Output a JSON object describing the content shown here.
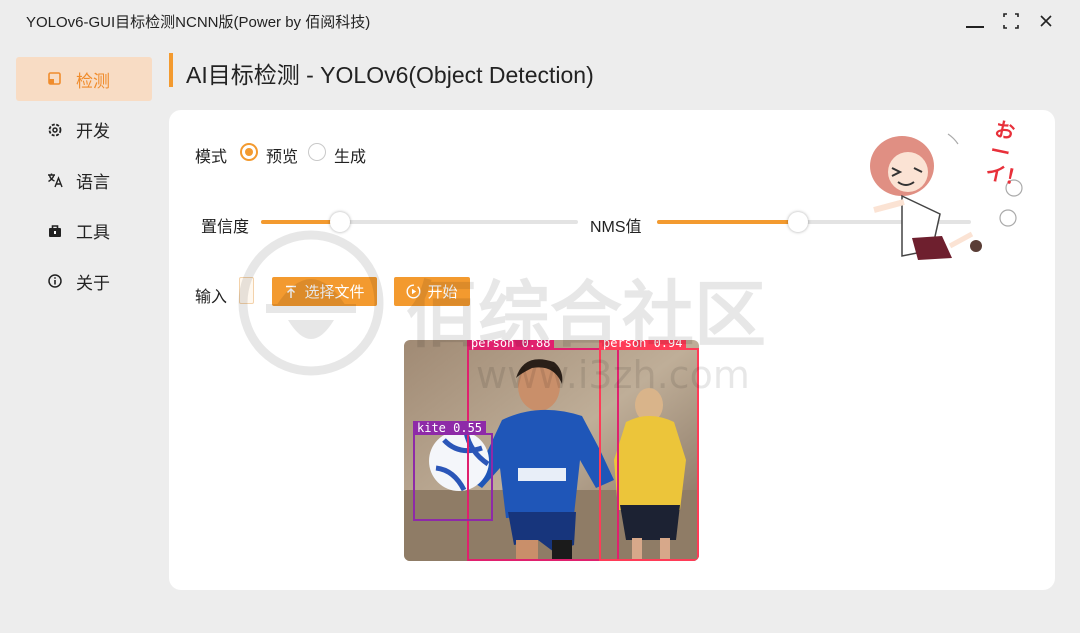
{
  "window": {
    "title": "YOLOv6-GUI目标检测NCNN版(Power by 佰阅科技)"
  },
  "sidebar": {
    "items": [
      {
        "label": "检测",
        "icon": "detect-icon",
        "active": true
      },
      {
        "label": "开发",
        "icon": "gear-icon",
        "active": false
      },
      {
        "label": "语言",
        "icon": "translate-icon",
        "active": false
      },
      {
        "label": "工具",
        "icon": "toolbox-icon",
        "active": false
      },
      {
        "label": "关于",
        "icon": "info-icon",
        "active": false
      }
    ]
  },
  "header": {
    "title": "AI目标检测 - YOLOv6(Object Detection)"
  },
  "mode": {
    "label": "模式",
    "options": [
      {
        "label": "预览",
        "selected": true
      },
      {
        "label": "生成",
        "selected": false
      }
    ]
  },
  "confidence": {
    "label": "置信度",
    "value": 0.25
  },
  "nms": {
    "label": "NMS值",
    "value": 0.45
  },
  "input": {
    "label": "输入",
    "value": "",
    "choose_file_label": "选择文件",
    "start_label": "开始"
  },
  "detections": [
    {
      "label": "person 0.88",
      "color": "#e0206e"
    },
    {
      "label": "person 0.94",
      "color": "#ff3b57"
    },
    {
      "label": "kite 0.55",
      "color": "#8e2aa8"
    }
  ],
  "mascot_text": "おーイ！",
  "watermark": {
    "text": "佰综合社区",
    "url": "www.i3zh.com"
  },
  "colors": {
    "accent": "#f39a2f",
    "active_nav_bg": "#f8dcc4",
    "window_bg": "#ededed",
    "card_bg": "#ffffff"
  }
}
